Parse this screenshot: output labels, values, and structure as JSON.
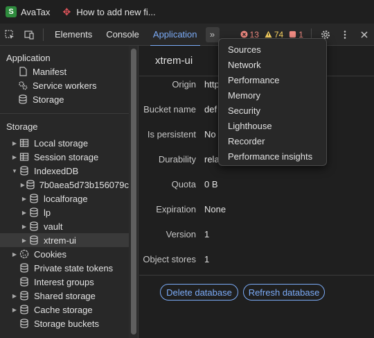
{
  "browser_tabs": [
    {
      "title": "AvaTax",
      "icon": "avatax-favicon"
    },
    {
      "title": "How to add new fi...",
      "icon": "red-logo-favicon"
    }
  ],
  "toolbar": {
    "tabs": [
      "Elements",
      "Console",
      "Application"
    ],
    "active_tab": "Application",
    "more_tabs_glyph": "»",
    "errors": "13",
    "warnings": "74",
    "issues": "1"
  },
  "sidebar": {
    "application_header": "Application",
    "application_items": [
      {
        "label": "Manifest",
        "icon": "file-icon"
      },
      {
        "label": "Service workers",
        "icon": "gears-icon"
      },
      {
        "label": "Storage",
        "icon": "database-icon"
      }
    ],
    "storage_header": "Storage",
    "storage_items": [
      {
        "label": "Local storage",
        "icon": "table-icon",
        "arrow": "▶"
      },
      {
        "label": "Session storage",
        "icon": "table-icon",
        "arrow": "▶"
      },
      {
        "label": "IndexedDB",
        "icon": "database-icon",
        "arrow": "▼"
      },
      {
        "label": "7b0aea5d73b156079c",
        "icon": "database-icon",
        "arrow": "▶"
      },
      {
        "label": "localforage",
        "icon": "database-icon",
        "arrow": "▶"
      },
      {
        "label": "lp",
        "icon": "database-icon",
        "arrow": "▶"
      },
      {
        "label": "vault",
        "icon": "database-icon",
        "arrow": "▶"
      },
      {
        "label": "xtrem-ui",
        "icon": "database-icon",
        "arrow": "▶"
      },
      {
        "label": "Cookies",
        "icon": "cookie-icon",
        "arrow": "▶"
      },
      {
        "label": "Private state tokens",
        "icon": "database-icon",
        "arrow": ""
      },
      {
        "label": "Interest groups",
        "icon": "database-icon",
        "arrow": ""
      },
      {
        "label": "Shared storage",
        "icon": "database-icon",
        "arrow": "▶"
      },
      {
        "label": "Cache storage",
        "icon": "database-icon",
        "arrow": "▶"
      },
      {
        "label": "Storage buckets",
        "icon": "database-icon",
        "arrow": ""
      }
    ],
    "selected": "xtrem-ui"
  },
  "main": {
    "title": "xtrem-ui",
    "rows": [
      {
        "key": "Origin",
        "value": "http"
      },
      {
        "key": "Bucket name",
        "value": "def"
      },
      {
        "key": "Is persistent",
        "value": "No"
      },
      {
        "key": "Durability",
        "value": "rela"
      },
      {
        "key": "Quota",
        "value": "0 B"
      },
      {
        "key": "Expiration",
        "value": "None"
      },
      {
        "key": "Version",
        "value": "1"
      },
      {
        "key": "Object stores",
        "value": "1"
      }
    ],
    "delete_label": "Delete database",
    "refresh_label": "Refresh database"
  },
  "dropdown": {
    "items": [
      "Sources",
      "Network",
      "Performance",
      "Memory",
      "Security",
      "Lighthouse",
      "Recorder",
      "Performance insights"
    ]
  },
  "colors": {
    "accent": "#7cacf8",
    "background": "#1f1f1f",
    "panel": "#282828",
    "error": "#f28b82",
    "warning": "#fdd663"
  }
}
